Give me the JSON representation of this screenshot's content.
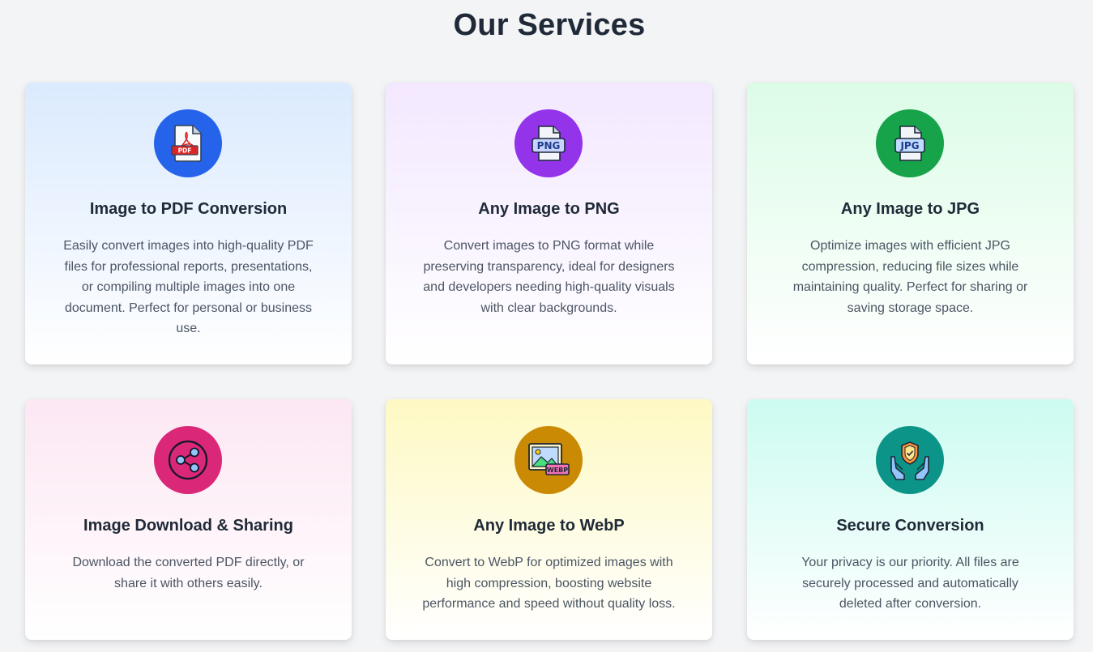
{
  "page": {
    "title": "Our Services"
  },
  "services": [
    {
      "title": "Image to PDF Conversion",
      "description": "Easily convert images into high-quality PDF files for professional reports, presentations, or compiling multiple images into one document. Perfect for personal or business use.",
      "icon": "pdf-file-icon",
      "icon_label": "PDF",
      "icon_bg": "#2563eb",
      "gradient": [
        "#dbeafe",
        "#ffffff"
      ]
    },
    {
      "title": "Any Image to PNG",
      "description": "Convert images to PNG format while preserving transparency, ideal for designers and developers needing high-quality visuals with clear backgrounds.",
      "icon": "png-file-icon",
      "icon_label": "PNG",
      "icon_bg": "#9333ea",
      "gradient": [
        "#f3e8ff",
        "#ffffff"
      ]
    },
    {
      "title": "Any Image to JPG",
      "description": "Optimize images with efficient JPG compression, reducing file sizes while maintaining quality. Perfect for sharing or saving storage space.",
      "icon": "jpg-file-icon",
      "icon_label": "JPG",
      "icon_bg": "#16a34a",
      "gradient": [
        "#dcfce7",
        "#ffffff"
      ]
    },
    {
      "title": "Image Download & Sharing",
      "description": "Download the converted PDF directly, or share it with others easily.",
      "icon": "share-icon",
      "icon_bg": "#db2777",
      "gradient": [
        "#fce7f3",
        "#ffffff"
      ]
    },
    {
      "title": "Any Image to WebP",
      "description": "Convert to WebP for optimized images with high compression, boosting website performance and speed without quality loss.",
      "icon": "webp-image-icon",
      "icon_label": "WEBP",
      "icon_bg": "#ca8a04",
      "gradient": [
        "#fef9c3",
        "#ffffff"
      ]
    },
    {
      "title": "Secure Conversion",
      "description": "Your privacy is our priority. All files are securely processed and automatically deleted after conversion.",
      "icon": "secure-hands-shield-icon",
      "icon_bg": "#0d9488",
      "gradient": [
        "#ccfbf1",
        "#ffffff"
      ]
    }
  ]
}
